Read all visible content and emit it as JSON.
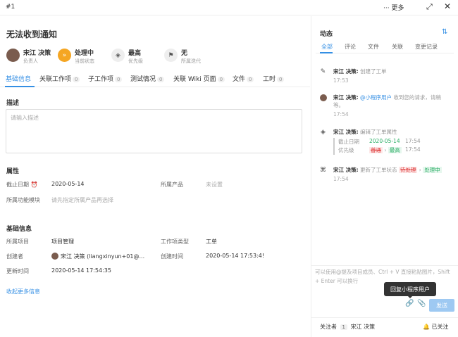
{
  "topbar": {
    "issue_id": "#1",
    "more_label": "··· 更多",
    "expand_icon": "expand-icon",
    "close_icon": "close-icon"
  },
  "issue": {
    "title": "无法收到通知"
  },
  "meta": [
    {
      "main": "宋江 决策",
      "sub": "负责人",
      "icon": "avatar"
    },
    {
      "main": "处理中",
      "sub": "当前状态",
      "icon": "status-icon",
      "color": "#f5a623"
    },
    {
      "main": "最高",
      "sub": "优先级",
      "icon": "priority-icon"
    },
    {
      "main": "无",
      "sub": "所属迭代",
      "icon": "flag-icon"
    }
  ],
  "tabs": [
    {
      "label": "基础信息",
      "count": ""
    },
    {
      "label": "关联工作项",
      "count": "0"
    },
    {
      "label": "子工作项",
      "count": "0"
    },
    {
      "label": "测试情况",
      "count": "0"
    },
    {
      "label": "关联 Wiki 页面",
      "count": "0"
    },
    {
      "label": "文件",
      "count": "0"
    },
    {
      "label": "工时",
      "count": "0"
    }
  ],
  "description": {
    "title": "描述",
    "placeholder": "请输入描述"
  },
  "properties": {
    "title": "属性",
    "due_label": "截止日期",
    "due_value": "2020-05-14",
    "product_label": "所属产品",
    "product_value": "未设置",
    "module_label": "所属功能模块",
    "module_value": "请先指定所属产品再选择"
  },
  "basic": {
    "title": "基础信息",
    "project_label": "所属项目",
    "project_value": "项目管理",
    "type_label": "工作项类型",
    "type_value": "工单",
    "creator_label": "创建者",
    "creator_value": "宋江 决策 (liangxinyun+01@...",
    "created_label": "创建时间",
    "created_value": "2020-05-14 17:53:4!",
    "updated_label": "更新时间",
    "updated_value": "2020-05-14 17:54:35",
    "collapse_link": "收起更多信息"
  },
  "activity": {
    "title": "动态",
    "tabs": [
      "全部",
      "评论",
      "文件",
      "关联",
      "变更记录"
    ],
    "items": [
      {
        "user": "宋江 决策:",
        "text": "创建了工单",
        "time": "17:53"
      },
      {
        "user": "宋江 决策:",
        "mention": "@小程序用户",
        "text": "收到您的请求，请稍",
        "text2": "等。",
        "time": "17:54"
      },
      {
        "user": "宋江 决策:",
        "text": "编辑了工单属性",
        "time": "17:54",
        "changes": [
          {
            "label": "截止日期",
            "value": "2020-05-14",
            "time": "17:54"
          },
          {
            "label": "优先级",
            "from": "普通",
            "arrow": "›",
            "to": "最高",
            "time": "17:54"
          }
        ]
      },
      {
        "user": "宋江 决策:",
        "text": "更新了工单状态",
        "from": "待处理",
        "arrow": "›",
        "to": "处理中",
        "time": "17:54"
      }
    ]
  },
  "comment": {
    "placeholder": "可以使用@提及项目成员、Ctrl + V 直接粘贴图片，Shift + Enter 可以换行",
    "tooltip": "回复小程序用户",
    "send_label": "发送"
  },
  "footer": {
    "watcher_label": "关注者",
    "watcher_count": "1",
    "watcher_name": "宋江 决策",
    "followed_label": "已关注"
  }
}
